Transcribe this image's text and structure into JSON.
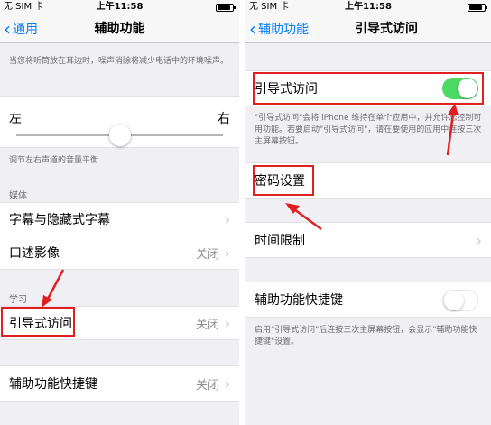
{
  "left": {
    "status": {
      "carrier": "无 SIM 卡",
      "time": "上午11:58"
    },
    "nav": {
      "back_label": "通用",
      "title": "辅助功能"
    },
    "noise_note": "当您将听筒放在耳边时，噪声消除将减少电话中的环境噪声。",
    "balance": {
      "left_label": "左",
      "right_label": "右",
      "position": 0.5
    },
    "balance_note": "调节左右声道的音量平衡",
    "media_header": "媒体",
    "media_items": [
      {
        "label": "字幕与隐藏式字幕",
        "value": ""
      },
      {
        "label": "口述影像",
        "value": "关闭"
      }
    ],
    "learning_header": "学习",
    "guided_access": {
      "label": "引导式访问",
      "value": "关闭"
    },
    "shortcut": {
      "label": "辅助功能快捷键",
      "value": "关闭"
    }
  },
  "right": {
    "status": {
      "carrier": "无 SIM 卡",
      "time": "上午11:58"
    },
    "nav": {
      "back_label": "辅助功能",
      "title": "引导式访问"
    },
    "guided_toggle": {
      "label": "引导式访问",
      "on": true
    },
    "guided_note": "\"引导式访问\"会将 iPhone 维持在单个应用中，并允许您控制可用功能。若要启动\"引导式访问\"，请在要使用的应用中连按三次主屏幕按钮。",
    "passcode": {
      "label": "密码设置"
    },
    "time_limit": {
      "label": "时间限制"
    },
    "shortcut": {
      "label": "辅助功能快捷键",
      "on": false
    },
    "shortcut_note": "启用\"引导式访问\"后连按三次主屏幕按钮，会显示\"辅助功能快捷键\"设置。"
  },
  "colors": {
    "accent": "#007aff",
    "toggle_on": "#4cd964",
    "annotation": "#e02020"
  },
  "icons": [
    "chevron-left-icon",
    "chevron-right-icon",
    "battery-icon",
    "arrow-annotation-icon"
  ]
}
